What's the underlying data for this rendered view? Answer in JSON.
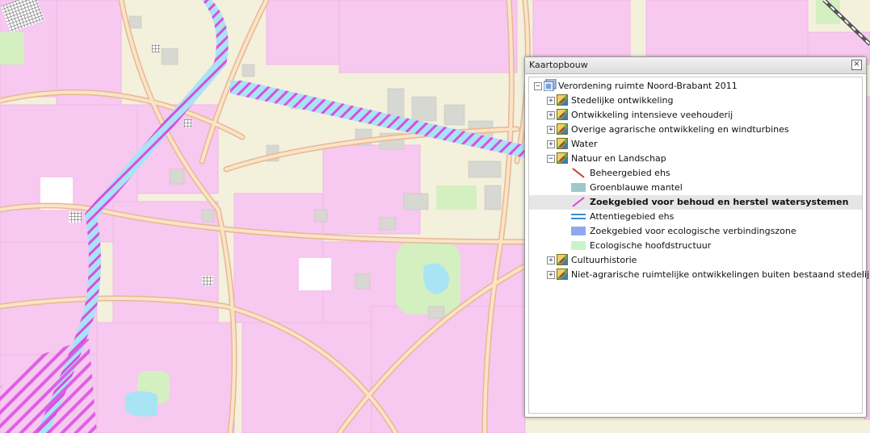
{
  "panel": {
    "title": "Kaartopbouw",
    "close_icon": "close-icon"
  },
  "tree": {
    "root": "Verordening ruimte Noord-Brabant 2011",
    "groups": [
      "Stedelijke ontwikkeling",
      "Ontwikkeling intensieve veehouderij",
      "Overige agrarische ontwikkeling en windturbines",
      "Water",
      "Natuur en Landschap",
      "Cultuurhistorie",
      "Niet-agrarische ruimtelijke ontwikkelingen buiten bestaand stedelijk gebied"
    ],
    "natuur_items": [
      {
        "label": "Beheergebied ehs",
        "symbol": "diagonal-line-orange-red",
        "color": "#c0442a"
      },
      {
        "label": "Groenblauwe mantel",
        "symbol": "fill-teal",
        "color": "#9fc9c9"
      },
      {
        "label": "Zoekgebied voor behoud en herstel watersystemen",
        "symbol": "diagonal-line-magenta",
        "color": "#e040e0",
        "selected": true
      },
      {
        "label": "Attentiegebied ehs",
        "symbol": "double-line-blue",
        "color": "#3a8fd0"
      },
      {
        "label": "Zoekgebied voor ecologische verbindingszone",
        "symbol": "fill-blue",
        "color": "#8fa8f0"
      },
      {
        "label": "Ecologische hoofdstructuur",
        "symbol": "fill-light-green",
        "color": "#c8f5c8"
      }
    ]
  },
  "map_colors": {
    "background": "#f3f0dc",
    "urban": "#f7c8f0",
    "road": "#fbe3c6",
    "road_edge": "#e6b894",
    "water": "#a8e4f4",
    "hatch": "#d94ee0",
    "green": "#d4f0c0",
    "building": "#d8d8d2",
    "railway": "#555555"
  }
}
